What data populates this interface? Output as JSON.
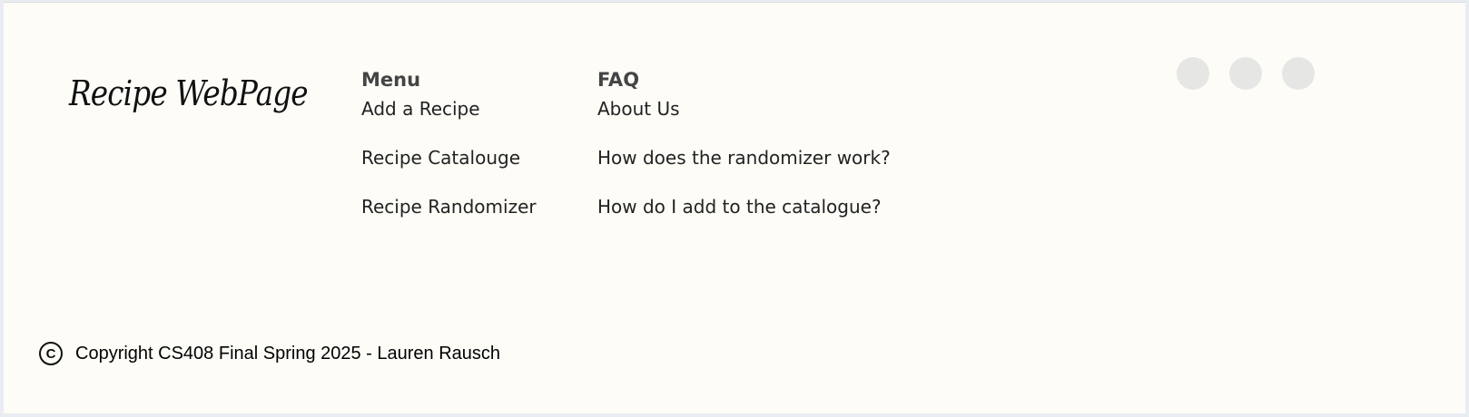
{
  "brand": {
    "logo_text": "Recipe WebPage"
  },
  "menu": {
    "heading": "Menu",
    "links": [
      "Add a Recipe",
      "Recipe Catalouge",
      "Recipe Randomizer"
    ]
  },
  "faq": {
    "heading": "FAQ",
    "links": [
      "About Us",
      "How does the randomizer work?",
      "How do I add to the catalogue?"
    ]
  },
  "social": {
    "icons": [
      "social-icon",
      "social-icon",
      "social-icon"
    ],
    "color": "#e6e6e4"
  },
  "copyright": {
    "symbol": "C",
    "text": "Copyright CS408 Final Spring 2025 - Lauren Rausch"
  },
  "colors": {
    "background": "#fdfcf7",
    "heading": "#444444",
    "link": "#222222"
  }
}
